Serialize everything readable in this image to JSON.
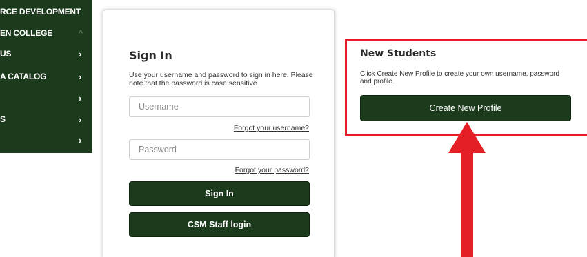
{
  "sidebar": {
    "items": [
      {
        "label": "RCE DEVELOPMENT",
        "chevron": ""
      },
      {
        "label": "EN COLLEGE",
        "chevron": "^"
      },
      {
        "label": "US",
        "chevron": "›"
      },
      {
        "label": "A CATALOG",
        "chevron": "›"
      },
      {
        "label": "",
        "chevron": "›"
      },
      {
        "label": "S",
        "chevron": "›"
      },
      {
        "label": "",
        "chevron": "›"
      }
    ]
  },
  "signin": {
    "title": "Sign In",
    "description": "Use your username and password to sign in here. Please note that the password is case sensitive.",
    "username_placeholder": "Username",
    "forgot_username": "Forgot your username?",
    "password_placeholder": "Password",
    "forgot_password": "Forgot your password?",
    "signin_button": "Sign In",
    "staff_login_button": "CSM Staff login"
  },
  "new_students": {
    "title": "New Students",
    "description": "Click Create New Profile to create your own username, password and profile.",
    "create_button": "Create New Profile"
  },
  "colors": {
    "brand_green": "#1c3a1c",
    "highlight_red": "#e31e25"
  },
  "icons": {
    "chevron": "chevron-right-icon",
    "arrow": "red-arrow-annotation"
  }
}
